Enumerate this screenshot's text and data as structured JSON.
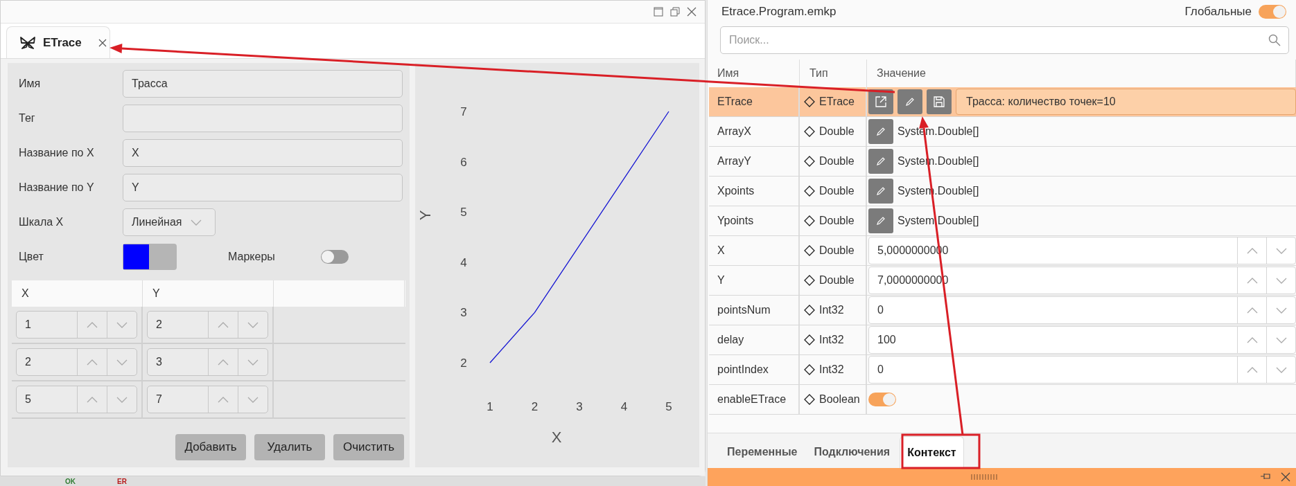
{
  "editor_window": {
    "tab": {
      "label": "ETrace",
      "selected": true
    },
    "form": {
      "fields": [
        {
          "label": "Имя",
          "value": "Трасса"
        },
        {
          "label": "Тег"
        },
        {
          "label": "Название по X",
          "value": "X"
        },
        {
          "label": "Название по Y",
          "value": "Y"
        }
      ],
      "scale": {
        "label": "Шкала X",
        "value": "Линейная"
      },
      "color": {
        "label": "Цвет",
        "color": "#0000ff"
      },
      "markers": {
        "label": "Маркеры",
        "on": false
      }
    },
    "points": {
      "columns": [
        "X",
        "Y"
      ],
      "rows": [
        [
          "1",
          "2"
        ],
        [
          "2",
          "3"
        ],
        [
          "5",
          "7"
        ]
      ]
    },
    "buttons": [
      "Добавить",
      "Удалить",
      "Очистить"
    ],
    "chart_data": {
      "type": "line",
      "xlabel": "X",
      "ylabel": "Y",
      "x": [
        1,
        2,
        5
      ],
      "series": [
        {
          "color": "#1414d2",
          "values": [
            2,
            3,
            7
          ]
        }
      ],
      "xlim": [
        1,
        5
      ],
      "ylim": [
        2,
        7
      ],
      "xticks": [
        1,
        2,
        3,
        4,
        5
      ],
      "yticks": [
        2,
        3,
        4,
        5,
        6,
        7
      ]
    }
  },
  "canvas_labels": [
    {
      "text": "OK",
      "color": "#2e7d32"
    },
    {
      "text": "ER",
      "color": "#b71c1c"
    }
  ],
  "variables_panel": {
    "file": "Etrace.Program.emkp",
    "globals": {
      "label": "Глобальные",
      "on": true
    },
    "search": {
      "placeholder": "Поиск..."
    },
    "columns": [
      "Имя",
      "Тип",
      "Значение"
    ],
    "rows": [
      {
        "name": "ETrace",
        "type": "ETrace",
        "kind": "object",
        "value": "Трасса: количество точек=10",
        "selected": true
      },
      {
        "name": "ArrayX",
        "type": "Double",
        "kind": "array",
        "value": "System.Double[]",
        "selected": false
      },
      {
        "name": "ArrayY",
        "type": "Double",
        "kind": "array",
        "value": "System.Double[]",
        "selected": false
      },
      {
        "name": "Xpoints",
        "type": "Double",
        "kind": "array",
        "value": "System.Double[]",
        "selected": false
      },
      {
        "name": "Ypoints",
        "type": "Double",
        "kind": "array",
        "value": "System.Double[]",
        "selected": false
      },
      {
        "name": "X",
        "type": "Double",
        "kind": "number",
        "value": "5,0000000000",
        "selected": false
      },
      {
        "name": "Y",
        "type": "Double",
        "kind": "number",
        "value": "7,0000000000",
        "selected": false
      },
      {
        "name": "pointsNum",
        "type": "Int32",
        "kind": "number",
        "value": "0",
        "selected": false
      },
      {
        "name": "delay",
        "type": "Int32",
        "kind": "number",
        "value": "100",
        "selected": false
      },
      {
        "name": "pointIndex",
        "type": "Int32",
        "kind": "number",
        "value": "0",
        "selected": false
      },
      {
        "name": "enableETrace",
        "type": "Boolean",
        "kind": "boolean",
        "on": true,
        "selected": false
      }
    ],
    "tabs": [
      {
        "label": "Переменные",
        "selected": false
      },
      {
        "label": "Подключения",
        "selected": false
      },
      {
        "label": "Контекст",
        "selected": true
      }
    ]
  }
}
